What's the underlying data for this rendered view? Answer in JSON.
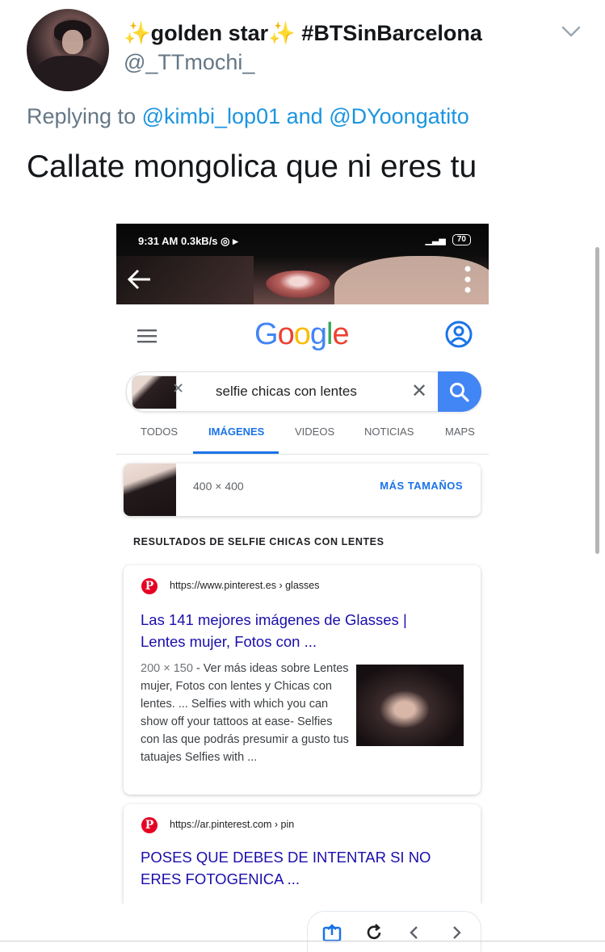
{
  "tweet": {
    "display_name_emoji": "✨",
    "display_name": "golden star",
    "hashtag": "#BTSinBarcelona",
    "handle": "@_TTmochi_",
    "replying_to_prefix": "Replying to",
    "mention_1": "@kimbi_lop01",
    "and_word": "and",
    "mention_2": "@DYoongatito",
    "text": "Callate mongolica que ni eres tu"
  },
  "phone": {
    "status_time": "9:31 AM",
    "status_speed": "0.3kB/s",
    "battery": "70",
    "google_logo": [
      "G",
      "o",
      "o",
      "g",
      "l",
      "e"
    ],
    "logo_colors": [
      "#4285f4",
      "#ea4335",
      "#fbbc05",
      "#4285f4",
      "#34a853",
      "#ea4335"
    ],
    "search_query": "selfie chicas con lentes",
    "tabs": [
      "TODOS",
      "IMÁGENES",
      "VIDEOS",
      "NOTICIAS",
      "MAPS"
    ],
    "active_tab": "IMÁGENES",
    "image_dims": "400 × 400",
    "more_sizes": "MÁS TAMAÑOS",
    "results_heading": "RESULTADOS DE SELFIE CHICAS CON LENTES",
    "results": [
      {
        "url": "https://www.pinterest.es › glasses",
        "title": "Las 141 mejores imágenes de Glasses | Lentes mujer, Fotos con ...",
        "meta": "200 × 150",
        "snippet": " - Ver más ideas sobre Lentes mujer, Fotos con lentes y Chicas con lentes. ... Selfies with which you can show off your tattoos at ease- Selfies con las que podrás presumir a gusto tus tatuajes Selfies with ..."
      },
      {
        "url": "https://ar.pinterest.com › pin",
        "title": "POSES QUE DEBES DE INTENTAR SI NO ERES FOTOGENICA ..."
      }
    ]
  },
  "colors": {
    "mention_blue": "#1b95e0",
    "google_blue": "#1a73e8",
    "link_blue": "#1a0dab",
    "pinterest_red": "#e60023"
  }
}
